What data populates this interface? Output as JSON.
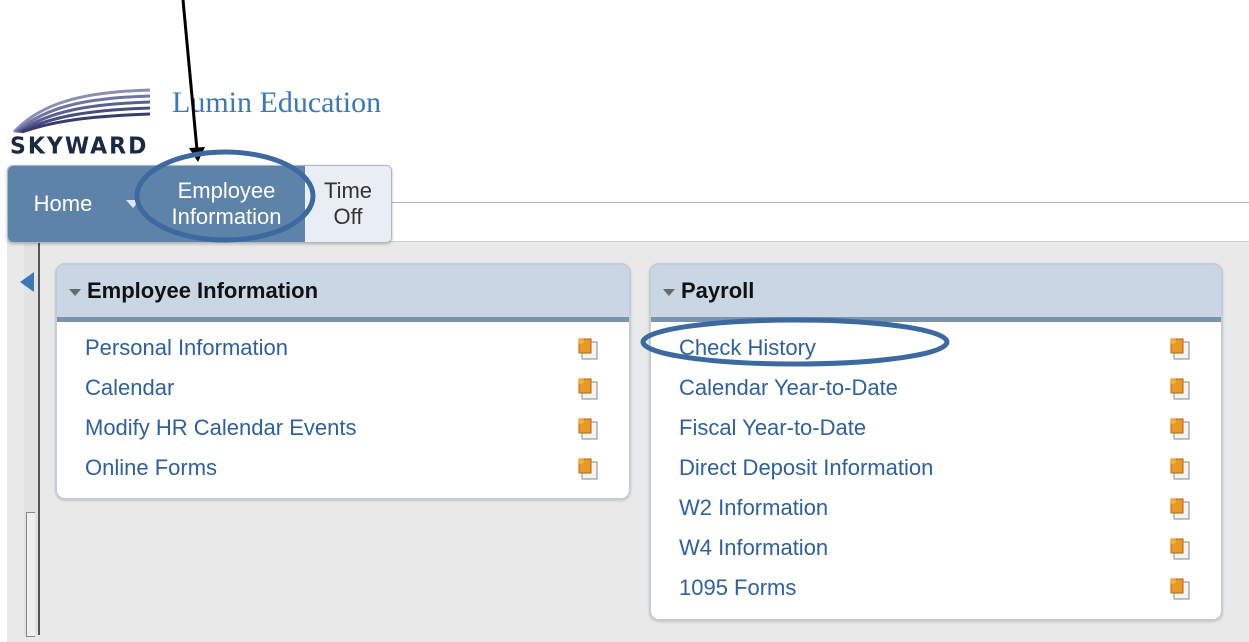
{
  "header": {
    "logo_text": "SKYWARD",
    "district_name": "Lumin Education"
  },
  "tabs": [
    {
      "label_line1": "Home",
      "label_line2": ""
    },
    {
      "label_line1": "Employee",
      "label_line2": "Information"
    },
    {
      "label_line1": "Time",
      "label_line2": "Off"
    }
  ],
  "widgets": {
    "employee_information": {
      "title": "Employee Information",
      "items": [
        "Personal Information",
        "Calendar",
        "Modify HR Calendar Events",
        "Online Forms"
      ]
    },
    "payroll": {
      "title": "Payroll",
      "items": [
        "Check History",
        "Calendar Year-to-Date",
        "Fiscal Year-to-Date",
        "Direct Deposit Information",
        "W2 Information",
        "W4 Information",
        "1095 Forms"
      ]
    }
  },
  "colors": {
    "tab_active": "#5e83a9",
    "link": "#2f5f9e",
    "widget_header": "#c9d6e3",
    "annotation": "#3c6aa0"
  },
  "icons": {
    "tab_menu": "chevron-down-icon",
    "widget_item": "document-icon",
    "rail_collapse": "triangle-left-icon"
  }
}
